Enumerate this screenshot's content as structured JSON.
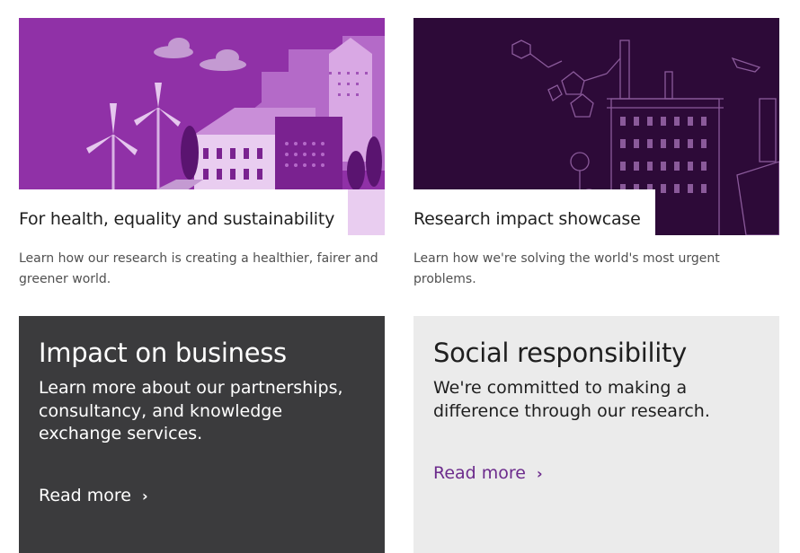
{
  "cards": [
    {
      "title": "For health, equality and sustainability",
      "description": "Learn how our research is creating a healthier, fairer and greener world.",
      "image": "purple-city-windturbines-illustration"
    },
    {
      "title": "Research impact showcase",
      "description": "Learn how we're solving the world's most urgent problems.",
      "image": "dark-purple-factory-molecule-illustration"
    }
  ],
  "panels": [
    {
      "title": "Impact on business",
      "text": "Learn more about our partnerships, consultancy, and knowledge exchange services.",
      "link": "Read more",
      "icon": "chevron-right-icon"
    },
    {
      "title": "Social responsibility",
      "text": "We're committed to making a difference through our research.",
      "link": "Read more",
      "icon": "chevron-right-icon"
    }
  ],
  "colors": {
    "brand_purple": "#6c2b8c",
    "dark_panel": "#3b3b3d",
    "light_panel": "#ebebeb",
    "illustration_purple": "#8a2aa0",
    "illustration_dark": "#2b0a36"
  }
}
